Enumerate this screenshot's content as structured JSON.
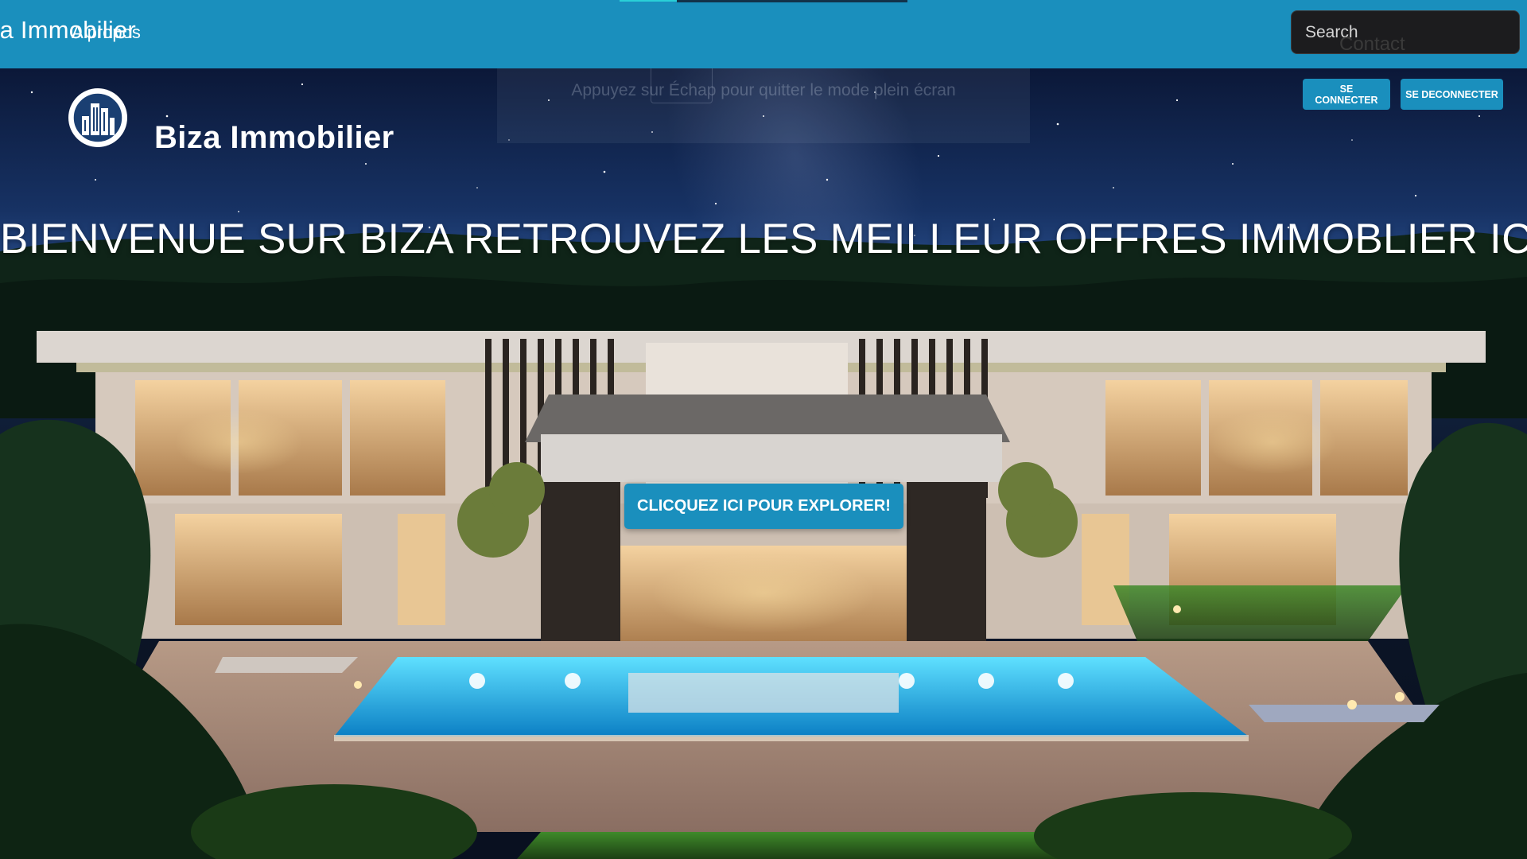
{
  "navbar": {
    "brand_partial": "Biza Immobilier",
    "links": [
      {
        "label": "A propos"
      }
    ],
    "search": {
      "placeholder": "Search"
    },
    "contact_label": "Contact"
  },
  "fullscreen_hint": {
    "text": "Appuyez sur Échap pour quitter le mode plein écran"
  },
  "header": {
    "logo_icon": "building-circle-icon",
    "site_title": "Biza Immobilier",
    "login_label": "Se connecter",
    "logout_label": "Se deconnecter"
  },
  "hero": {
    "heading": "BIENVENUE SUR BIZA RETROUVEZ LES MEILLEUR OFFRES IMMOBLIER ICI !",
    "cta_label": "Clicquez ici pour explorer!",
    "background": "night-luxury-villa-photo"
  },
  "colors": {
    "primary": "#1a8fbd",
    "search_bg": "#1c1c1e",
    "heading_text": "#ffffff"
  }
}
